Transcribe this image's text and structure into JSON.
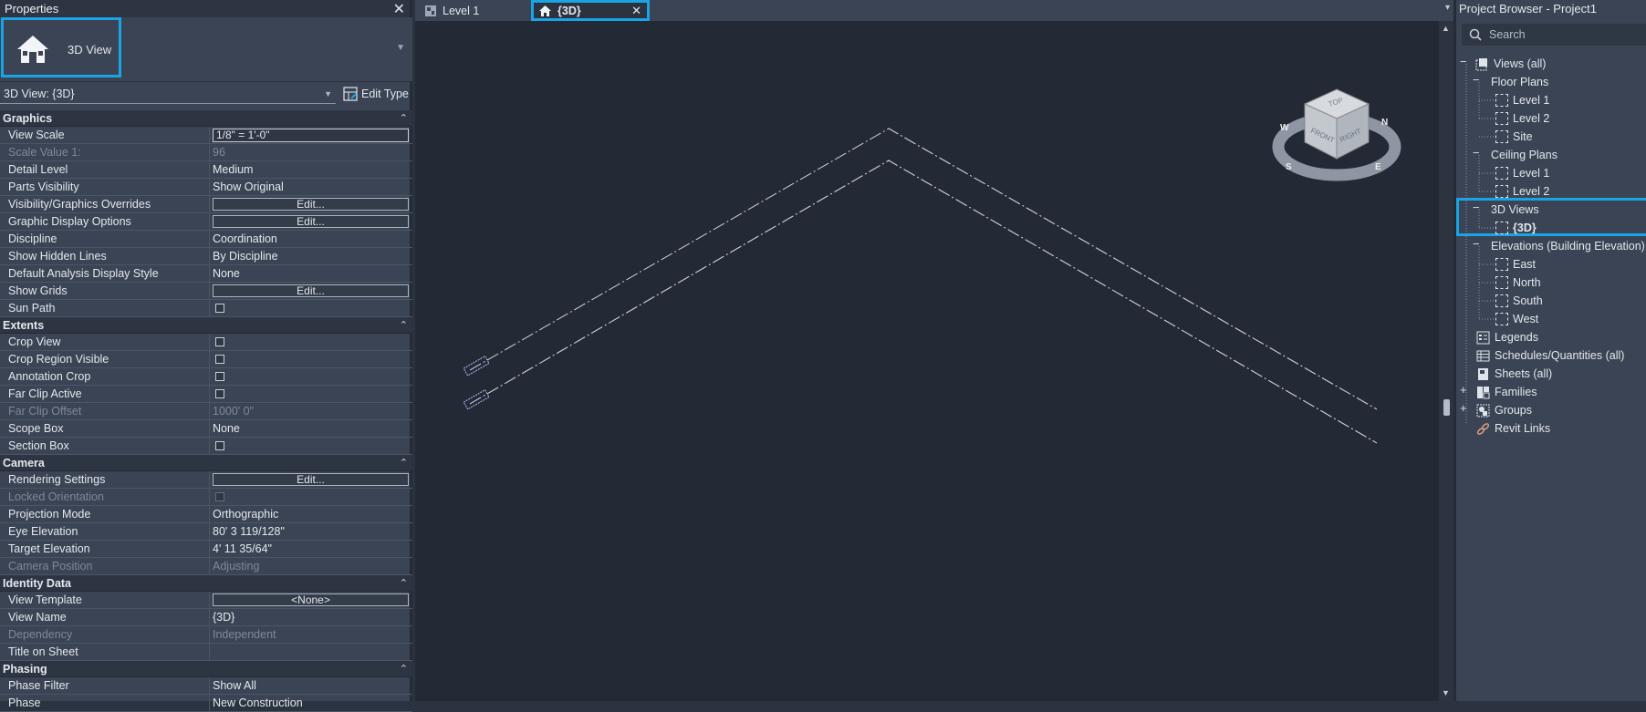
{
  "properties": {
    "title": "Properties",
    "type_name": "3D View",
    "view_selector": "3D View: {3D}",
    "edit_type": "Edit Type",
    "sections": [
      {
        "name": "Graphics",
        "rows": [
          {
            "k": "View Scale",
            "v": "1/8\" = 1'-0\"",
            "kind": "input"
          },
          {
            "k": "Scale Value    1:",
            "v": "96",
            "kind": "dis"
          },
          {
            "k": "Detail Level",
            "v": "Medium"
          },
          {
            "k": "Parts Visibility",
            "v": "Show Original"
          },
          {
            "k": "Visibility/Graphics Overrides",
            "v": "Edit...",
            "kind": "btn"
          },
          {
            "k": "Graphic Display Options",
            "v": "Edit...",
            "kind": "btn"
          },
          {
            "k": "Discipline",
            "v": "Coordination"
          },
          {
            "k": "Show Hidden Lines",
            "v": "By Discipline"
          },
          {
            "k": "Default Analysis Display Style",
            "v": "None"
          },
          {
            "k": "Show Grids",
            "v": "Edit...",
            "kind": "btn"
          },
          {
            "k": "Sun Path",
            "v": "",
            "kind": "cb"
          }
        ]
      },
      {
        "name": "Extents",
        "rows": [
          {
            "k": "Crop View",
            "v": "",
            "kind": "cb"
          },
          {
            "k": "Crop Region Visible",
            "v": "",
            "kind": "cb"
          },
          {
            "k": "Annotation Crop",
            "v": "",
            "kind": "cb"
          },
          {
            "k": "Far Clip Active",
            "v": "",
            "kind": "cb"
          },
          {
            "k": "Far Clip Offset",
            "v": "1000'  0\"",
            "kind": "dis"
          },
          {
            "k": "Scope Box",
            "v": "None"
          },
          {
            "k": "Section Box",
            "v": "",
            "kind": "cb"
          }
        ]
      },
      {
        "name": "Camera",
        "rows": [
          {
            "k": "Rendering Settings",
            "v": "Edit...",
            "kind": "btn"
          },
          {
            "k": "Locked Orientation",
            "v": "",
            "kind": "discb"
          },
          {
            "k": "Projection Mode",
            "v": "Orthographic"
          },
          {
            "k": "Eye Elevation",
            "v": "80'  3 119/128\""
          },
          {
            "k": "Target Elevation",
            "v": "4'  11 35/64\""
          },
          {
            "k": "Camera Position",
            "v": "Adjusting",
            "kind": "dis"
          }
        ]
      },
      {
        "name": "Identity Data",
        "rows": [
          {
            "k": "View Template",
            "v": "<None>",
            "kind": "btn"
          },
          {
            "k": "View Name",
            "v": "{3D}"
          },
          {
            "k": "Dependency",
            "v": "Independent",
            "kind": "dis"
          },
          {
            "k": "Title on Sheet",
            "v": ""
          }
        ]
      },
      {
        "name": "Phasing",
        "rows": [
          {
            "k": "Phase Filter",
            "v": "Show All"
          },
          {
            "k": "Phase",
            "v": "New Construction"
          }
        ]
      }
    ]
  },
  "tabs": [
    {
      "label": "Level 1",
      "active": false
    },
    {
      "label": "{3D}",
      "active": true
    }
  ],
  "viewcube": {
    "top": "TOP",
    "front": "FRONT",
    "right": "RIGHT",
    "compass": [
      "N",
      "E",
      "S",
      "W"
    ]
  },
  "browser": {
    "title": "Project Browser - Project1",
    "search_placeholder": "Search",
    "items": [
      {
        "label": "Views (all)"
      },
      {
        "label": "Floor Plans"
      },
      {
        "label": "Level 1"
      },
      {
        "label": "Level 2"
      },
      {
        "label": "Site"
      },
      {
        "label": "Ceiling Plans"
      },
      {
        "label": "Level 1"
      },
      {
        "label": "Level 2"
      },
      {
        "label": "3D Views"
      },
      {
        "label": "{3D}"
      },
      {
        "label": "Elevations (Building Elevation)"
      },
      {
        "label": "East"
      },
      {
        "label": "North"
      },
      {
        "label": "South"
      },
      {
        "label": "West"
      },
      {
        "label": "Legends"
      },
      {
        "label": "Schedules/Quantities (all)"
      },
      {
        "label": "Sheets (all)"
      },
      {
        "label": "Families"
      },
      {
        "label": "Groups"
      },
      {
        "label": "Revit Links"
      }
    ]
  },
  "colors": {
    "accent": "#1aa4e4",
    "panel": "#3b4454",
    "canvas": "#242a35"
  }
}
